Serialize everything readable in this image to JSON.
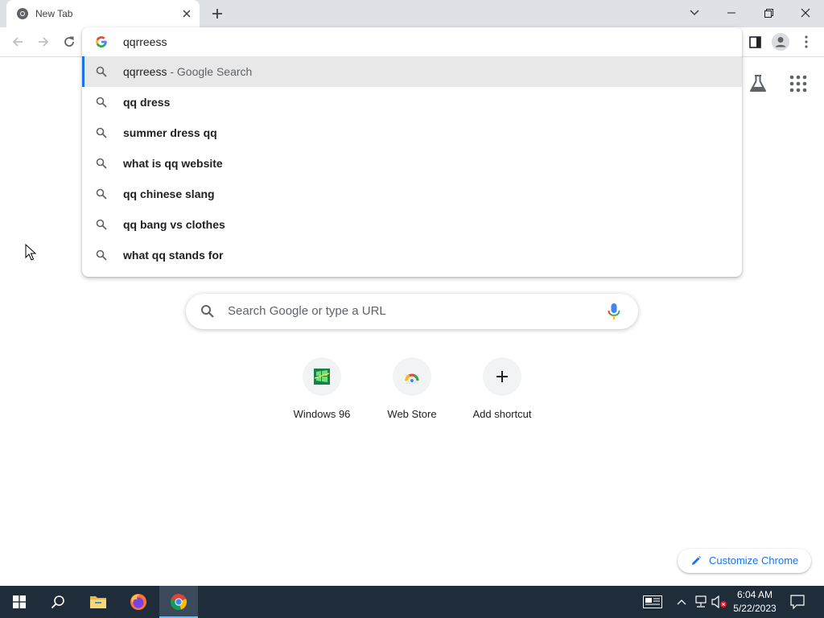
{
  "browser": {
    "tab_title": "New Tab",
    "omnibox_text": "qqrreess"
  },
  "suggestions": [
    {
      "bold": "",
      "normal": "qqrreess",
      "suffix": " - Google Search",
      "selected": true
    },
    {
      "bold": "qq dress",
      "normal": "",
      "suffix": "",
      "selected": false
    },
    {
      "bold": "summer dress qq",
      "normal": "",
      "suffix": "",
      "selected": false
    },
    {
      "bold": "what is qq website",
      "normal": "",
      "suffix": "",
      "selected": false
    },
    {
      "bold": "qq chinese slang",
      "normal": "",
      "suffix": "",
      "selected": false
    },
    {
      "bold": "qq bang vs clothes",
      "normal": "",
      "suffix": "",
      "selected": false
    },
    {
      "bold": "what qq stands for",
      "normal": "",
      "suffix": "",
      "selected": false
    }
  ],
  "ntp": {
    "search_placeholder": "Search Google or type a URL",
    "shortcuts": [
      {
        "label": "Windows 96",
        "icon": "windows96-icon"
      },
      {
        "label": "Web Store",
        "icon": "webstore-icon"
      },
      {
        "label": "Add shortcut",
        "icon": "plus-icon"
      }
    ],
    "customize_label": "Customize Chrome"
  },
  "taskbar": {
    "time": "6:04 AM",
    "date": "5/22/2023"
  },
  "colors": {
    "accent": "#1a73e8",
    "taskbar_bg": "#1f2c3a",
    "tabstrip_bg": "#dee1e6"
  }
}
